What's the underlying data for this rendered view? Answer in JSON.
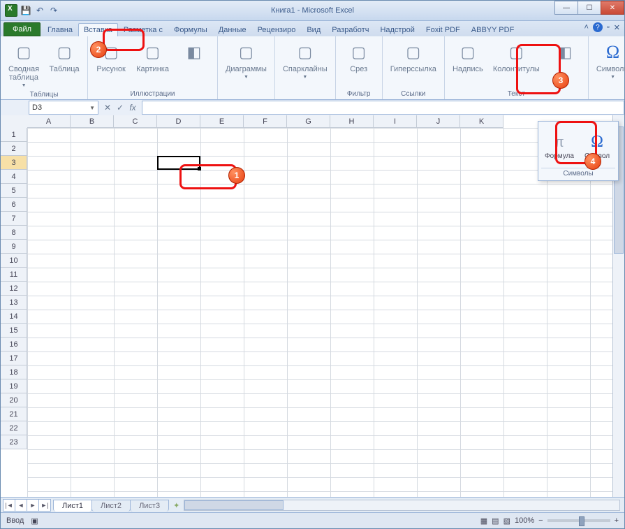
{
  "title": "Книга1 - Microsoft Excel",
  "qat": {
    "save": "💾",
    "undo": "↶",
    "redo": "↷"
  },
  "tabs": {
    "file": "Файл",
    "items": [
      "Главна",
      "Вставка",
      "Разметка с",
      "Формулы",
      "Данные",
      "Рецензиро",
      "Вид",
      "Разработч",
      "Надстрой",
      "Foxit PDF",
      "ABBYY PDF"
    ],
    "active_index": 1
  },
  "ribbon": {
    "groups": [
      {
        "name": "Таблицы",
        "buttons": [
          {
            "label": "Сводная\nтаблица",
            "dd": true
          },
          {
            "label": "Таблица"
          }
        ]
      },
      {
        "name": "Иллюстрации",
        "buttons": [
          {
            "label": "Рисунок"
          },
          {
            "label": "Картинка"
          },
          {
            "label": "",
            "icons": true
          }
        ]
      },
      {
        "name": "",
        "buttons": [
          {
            "label": "Диаграммы",
            "dd": true
          }
        ]
      },
      {
        "name": "",
        "buttons": [
          {
            "label": "Спарклайны",
            "dd": true
          }
        ]
      },
      {
        "name": "Фильтр",
        "buttons": [
          {
            "label": "Срез"
          }
        ]
      },
      {
        "name": "Ссылки",
        "buttons": [
          {
            "label": "Гиперссылка"
          }
        ]
      },
      {
        "name": "Текст",
        "buttons": [
          {
            "label": "Надпись"
          },
          {
            "label": "Колонтитулы"
          },
          {
            "label": "",
            "icons": true
          }
        ]
      },
      {
        "name": "",
        "buttons": [
          {
            "label": "Символы",
            "dd": true,
            "omega": true
          }
        ]
      }
    ]
  },
  "namebox": "D3",
  "columns": [
    "A",
    "B",
    "C",
    "D",
    "E",
    "F",
    "G",
    "H",
    "I",
    "J",
    "K"
  ],
  "rows": [
    "1",
    "2",
    "3",
    "4",
    "5",
    "6",
    "7",
    "8",
    "9",
    "10",
    "11",
    "12",
    "13",
    "14",
    "15",
    "16",
    "17",
    "18",
    "19",
    "20",
    "21",
    "22",
    "23"
  ],
  "selected_row_index": 2,
  "sheets": {
    "tabs": [
      "Лист1",
      "Лист2",
      "Лист3"
    ],
    "active": 0
  },
  "status": {
    "mode": "Ввод",
    "zoom": "100%"
  },
  "drop": {
    "formula": "Формула",
    "symbol": "Символ",
    "group": "Символы"
  },
  "callouts": {
    "c1": "1",
    "c2": "2",
    "c3": "3",
    "c4": "4"
  }
}
